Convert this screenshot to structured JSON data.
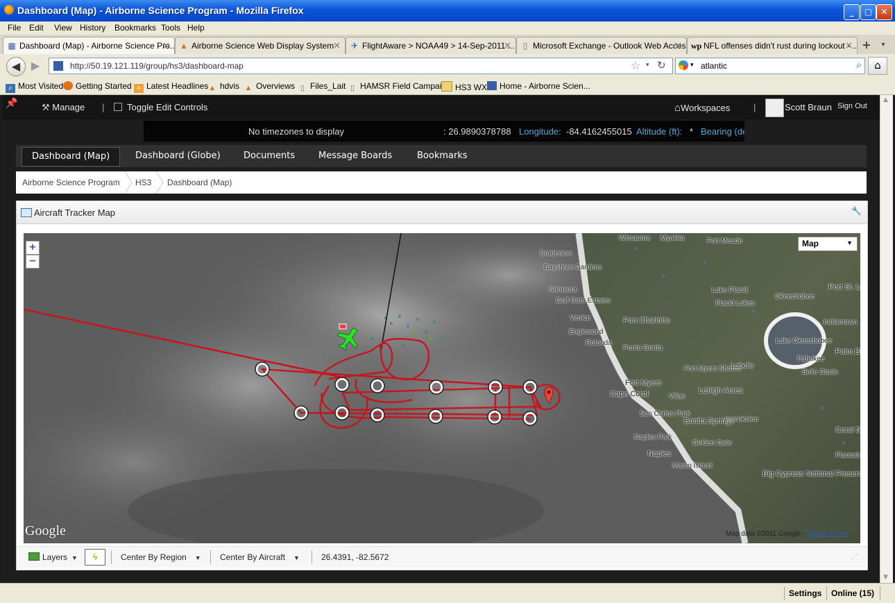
{
  "window": {
    "title": "Dashboard (Map) - Airborne Science Program - Mozilla Firefox"
  },
  "menu": [
    "File",
    "Edit",
    "View",
    "History",
    "Bookmarks",
    "Tools",
    "Help"
  ],
  "tabs": [
    {
      "label": "Dashboard (Map) - Airborne Science Pro...",
      "icon": "page-icon"
    },
    {
      "label": "Airborne Science Web Display System",
      "icon": "folder-icon"
    },
    {
      "label": "FlightAware > NOAA49 > 14-Sep-2011 ...",
      "icon": "plane-icon"
    },
    {
      "label": "Microsoft Exchange - Outlook Web Access",
      "icon": "page-icon"
    },
    {
      "label": "NFL offenses didn't rust during lockout - ...",
      "icon": "wp-icon"
    }
  ],
  "address": {
    "url": "http://50.19.121.119/group/hs3/dashboard-map"
  },
  "search": {
    "value": "atlantic"
  },
  "bookmarks": [
    "Most Visited",
    "Getting Started",
    "Latest Headlines",
    "hdvis",
    "Overviews",
    "Files_Lait",
    "HAMSR Field Campaign",
    "HS3 WX",
    "Home - Airborne Scien..."
  ],
  "topbar": {
    "manage": "Manage",
    "toggle": "Toggle Edit Controls",
    "workspaces": "Workspaces",
    "user": "Scott Braun",
    "signout": "Sign Out"
  },
  "infobar": {
    "tz": "No timezones to display",
    "lat": ": 26.9890378788",
    "lon_label": "Longitude:",
    "lon": "-84.4162455015",
    "alt_label": "Altitude (ft):",
    "alt": "*",
    "bearing": "Bearing (de"
  },
  "nav": [
    "Dashboard (Map)",
    "Dashboard (Globe)",
    "Documents",
    "Message Boards",
    "Bookmarks"
  ],
  "breadcrumb": [
    "Airborne Science Program",
    "HS3",
    "Dashboard (Map)"
  ],
  "panel": {
    "title": "Aircraft Tracker Map"
  },
  "map": {
    "type": "Map",
    "zoom_in": "+",
    "zoom_out": "−",
    "google": "Google",
    "data": "Map data ©2011 Google - ",
    "terms": "Terms of Use",
    "towns": [
      "Bradenton",
      "Bayshore Gardens",
      "Sarasota",
      "Gulf Gate Estates",
      "Venice",
      "Englewood",
      "Rotonda",
      "Port Charlotte",
      "Punta Gorda",
      "Fort Myers",
      "Cape Coral",
      "Villas",
      "San Carlos Park",
      "Bonita Springs",
      "Golden Gate",
      "Naples Park",
      "Naples",
      "Marco Island",
      "Lehigh Acres",
      "Immokalee",
      "Fort Myers Shores",
      "Labelle",
      "Lake Placid",
      "Placid Lakes",
      "Okeechobee",
      "Lake Okeechobee",
      "Pahokee",
      "Belle Glade",
      "Port St. Lucie",
      "Indiantown",
      "Palm Beach Gardens",
      "Coral Springs",
      "Plantation",
      "Big Cypress National Preserve",
      "Wimauma",
      "Myakka",
      "Fort Meade"
    ]
  },
  "tools": {
    "layers": "Layers",
    "region": "Center By Region",
    "aircraft": "Center By Aircraft",
    "coords": "26.4391, -82.5672"
  },
  "status": {
    "settings": "Settings",
    "online": "Online (15)"
  }
}
